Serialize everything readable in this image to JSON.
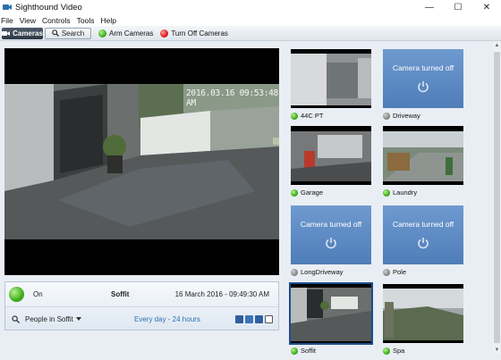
{
  "window": {
    "title": "Sighthound Video",
    "minimize": "—",
    "maximize": "☐",
    "close": "✕"
  },
  "menu": [
    "File",
    "View",
    "Controls",
    "Tools",
    "Help"
  ],
  "toolbar": {
    "cameras_tab": "Cameras",
    "search_tab": "Search",
    "arm_cameras": "Arm Cameras",
    "turn_off_cameras": "Turn Off Cameras"
  },
  "main_view": {
    "timestamp": "2016.03.16 09:53:48 AM"
  },
  "info": {
    "status": "On",
    "camera_name": "Soffit",
    "datetime": "16 March 2016 - 09:49:30 AM",
    "rule": "People in Soffit",
    "schedule": "Every day - 24 hours"
  },
  "off_text": "Camera turned off",
  "cameras": [
    {
      "name": "44C PT",
      "state": "on"
    },
    {
      "name": "Driveway",
      "state": "off"
    },
    {
      "name": "Garage",
      "state": "on"
    },
    {
      "name": "Laundry",
      "state": "on"
    },
    {
      "name": "LongDriveway",
      "state": "off"
    },
    {
      "name": "Pole",
      "state": "off"
    },
    {
      "name": "Soffit",
      "state": "on"
    },
    {
      "name": "Spa",
      "state": "on"
    }
  ],
  "colors": {
    "accent": "#2d6fb0",
    "active_tab": "#2d3744",
    "off_tile": "#5f8cc5",
    "status_on": "#3fae1c",
    "status_off": "#8a8a8a",
    "status_red": "#e01d1d"
  }
}
